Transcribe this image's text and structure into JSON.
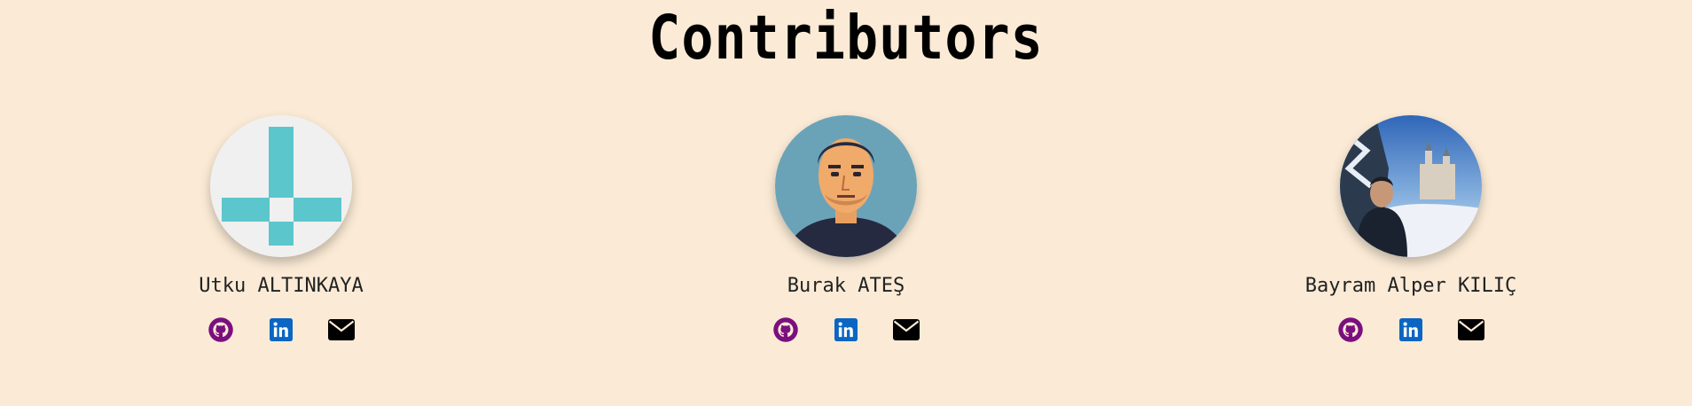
{
  "title": "Contributors",
  "contributors": [
    {
      "name": "Utku ALTINKAYA",
      "avatar": "identicon-avatar"
    },
    {
      "name": "Burak ATEŞ",
      "avatar": "portrait-avatar"
    },
    {
      "name": "Bayram Alper KILIÇ",
      "avatar": "castle-photo-avatar"
    }
  ],
  "icons": {
    "github": "github-icon",
    "linkedin": "linkedin-icon",
    "email": "email-icon"
  },
  "colors": {
    "background": "#fbebd6",
    "github": "#7b0f7e",
    "linkedin": "#0a66c2",
    "email": "#000000"
  }
}
